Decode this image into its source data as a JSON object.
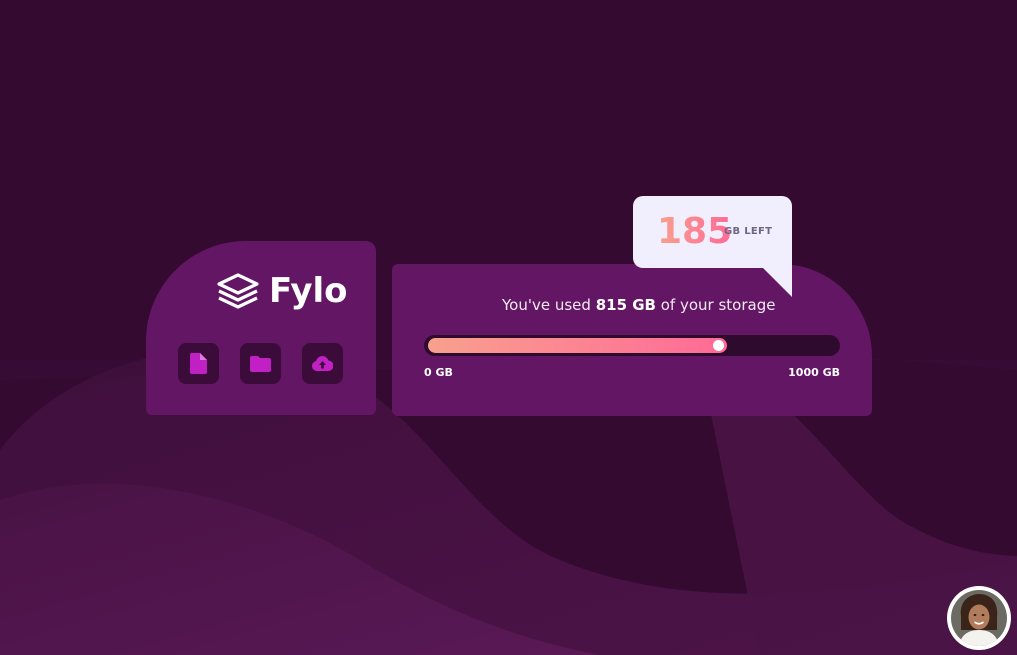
{
  "brand": {
    "name": "Fylo",
    "icon": "stacked-layers-icon"
  },
  "actions": [
    {
      "icon": "document-icon",
      "color": "#c020c4"
    },
    {
      "icon": "folder-icon",
      "color": "#c020c4"
    },
    {
      "icon": "cloud-upload-icon",
      "color": "#c020c4"
    }
  ],
  "storage": {
    "usage_prefix": "You've used ",
    "used_value": "815 GB",
    "usage_suffix": " of your storage",
    "min_label": "0 GB",
    "max_label": "1000 GB",
    "used_fraction": 0.815
  },
  "bubble": {
    "remaining_value": "185",
    "remaining_unit": "GB LEFT"
  },
  "colors": {
    "background": "#340a31",
    "card": "#631664",
    "gradient_start": "#f8a08e",
    "gradient_end": "#ff6a96",
    "bubble_background": "#f1effe"
  },
  "avatar": {
    "icon": "user-avatar"
  }
}
